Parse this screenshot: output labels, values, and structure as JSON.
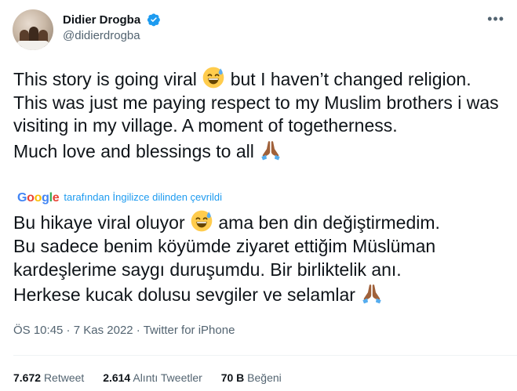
{
  "author": {
    "display_name": "Didier Drogba",
    "handle": "@didierdrogba"
  },
  "tweet": {
    "line1a": "This story is going viral ",
    "line1b": " but I haven’t changed religion.",
    "line2": "This was just me paying respect to my Muslim brothers i was visiting in my village. A moment of togetherness.",
    "line3a": "Much love and blessings to all "
  },
  "translation": {
    "logo": "Google",
    "label": "tarafından İngilizce dilinden çevrildi",
    "line1a": "Bu hikaye viral oluyor ",
    "line1b": " ama ben din değiştirmedim.",
    "line2": "Bu sadece benim köyümde ziyaret ettiğim Müslüman kardeşlerime saygı duruşumdu. Bir birliktelik anı.",
    "line3a": "Herkese kucak dolusu sevgiler ve selamlar "
  },
  "meta": {
    "time": "ÖS 10:45",
    "sep1": " · ",
    "date": "7 Kas 2022",
    "sep2": " · ",
    "source": "Twitter for iPhone"
  },
  "stats": {
    "retweets_count": "7.672",
    "retweets_label": "Retweet",
    "quotes_count": "2.614",
    "quotes_label": "Alıntı Tweetler",
    "likes_count": "70 B",
    "likes_label": "Beğeni"
  },
  "colors": {
    "accent": "#1d9bf0",
    "muted": "#536471",
    "text": "#0f1419"
  },
  "icons": {
    "verified": "verified-badge-icon",
    "more": "more-options-icon",
    "sweat": "grinning-sweat-emoji",
    "pray": "folded-hands-emoji"
  }
}
